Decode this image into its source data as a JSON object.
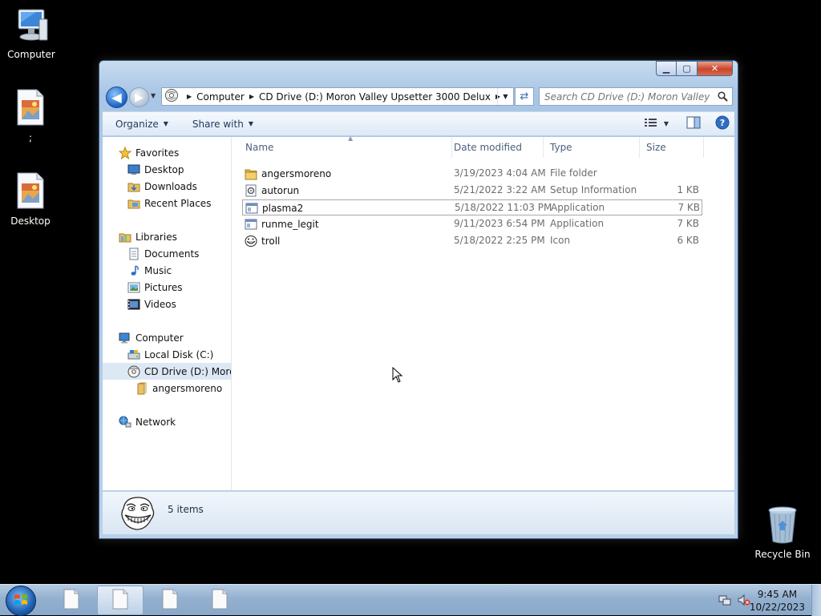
{
  "desktop": {
    "icons": [
      {
        "label": "Computer",
        "icon": "computer-icon"
      },
      {
        "label": ";",
        "icon": "image-file-icon"
      },
      {
        "label": "Desktop",
        "icon": "image-file-icon"
      },
      {
        "label": "Recycle Bin",
        "icon": "recycle-bin-icon"
      }
    ]
  },
  "window": {
    "buttons": {
      "minimize": "▁",
      "maximize": "▢",
      "close": "✕"
    },
    "address": {
      "crumbs": [
        "Computer",
        "CD Drive (D:) Moron Valley Upsetter 3000 Delux"
      ]
    },
    "search": {
      "placeholder": "Search CD Drive (D:) Moron Valley Up..."
    },
    "toolbar": {
      "organize_label": "Organize",
      "share_label": "Share with"
    },
    "nav": {
      "favorites": "Favorites",
      "desktop": "Desktop",
      "downloads": "Downloads",
      "recent_places": "Recent Places",
      "libraries": "Libraries",
      "documents": "Documents",
      "music": "Music",
      "pictures": "Pictures",
      "videos": "Videos",
      "computer": "Computer",
      "local_disk": "Local Disk (C:)",
      "cd_drive": "CD Drive (D:) Moron",
      "angersmoreno": "angersmoreno",
      "network": "Network"
    },
    "columns": {
      "name": "Name",
      "date": "Date modified",
      "type": "Type",
      "size": "Size"
    },
    "files": [
      {
        "name": "angersmoreno",
        "date": "3/19/2023 4:04 AM",
        "type": "File folder",
        "size": "",
        "icon": "folder-icon"
      },
      {
        "name": "autorun",
        "date": "5/21/2022 3:22 AM",
        "type": "Setup Information",
        "size": "1 KB",
        "icon": "setup-info-icon"
      },
      {
        "name": "plasma2",
        "date": "5/18/2022 11:03 PM",
        "type": "Application",
        "size": "7 KB",
        "icon": "application-icon"
      },
      {
        "name": "runme_legit",
        "date": "9/11/2023 6:54 PM",
        "type": "Application",
        "size": "7 KB",
        "icon": "application-icon"
      },
      {
        "name": "troll",
        "date": "5/18/2022 2:25 PM",
        "type": "Icon",
        "size": "6 KB",
        "icon": "troll-face-icon"
      }
    ],
    "details": {
      "count": "5 items"
    }
  },
  "taskbar": {
    "clock_time": "9:45 AM",
    "clock_date": "10/22/2023"
  },
  "colors": {
    "accent": "#1a62c8",
    "selection": "#dde8f5"
  }
}
